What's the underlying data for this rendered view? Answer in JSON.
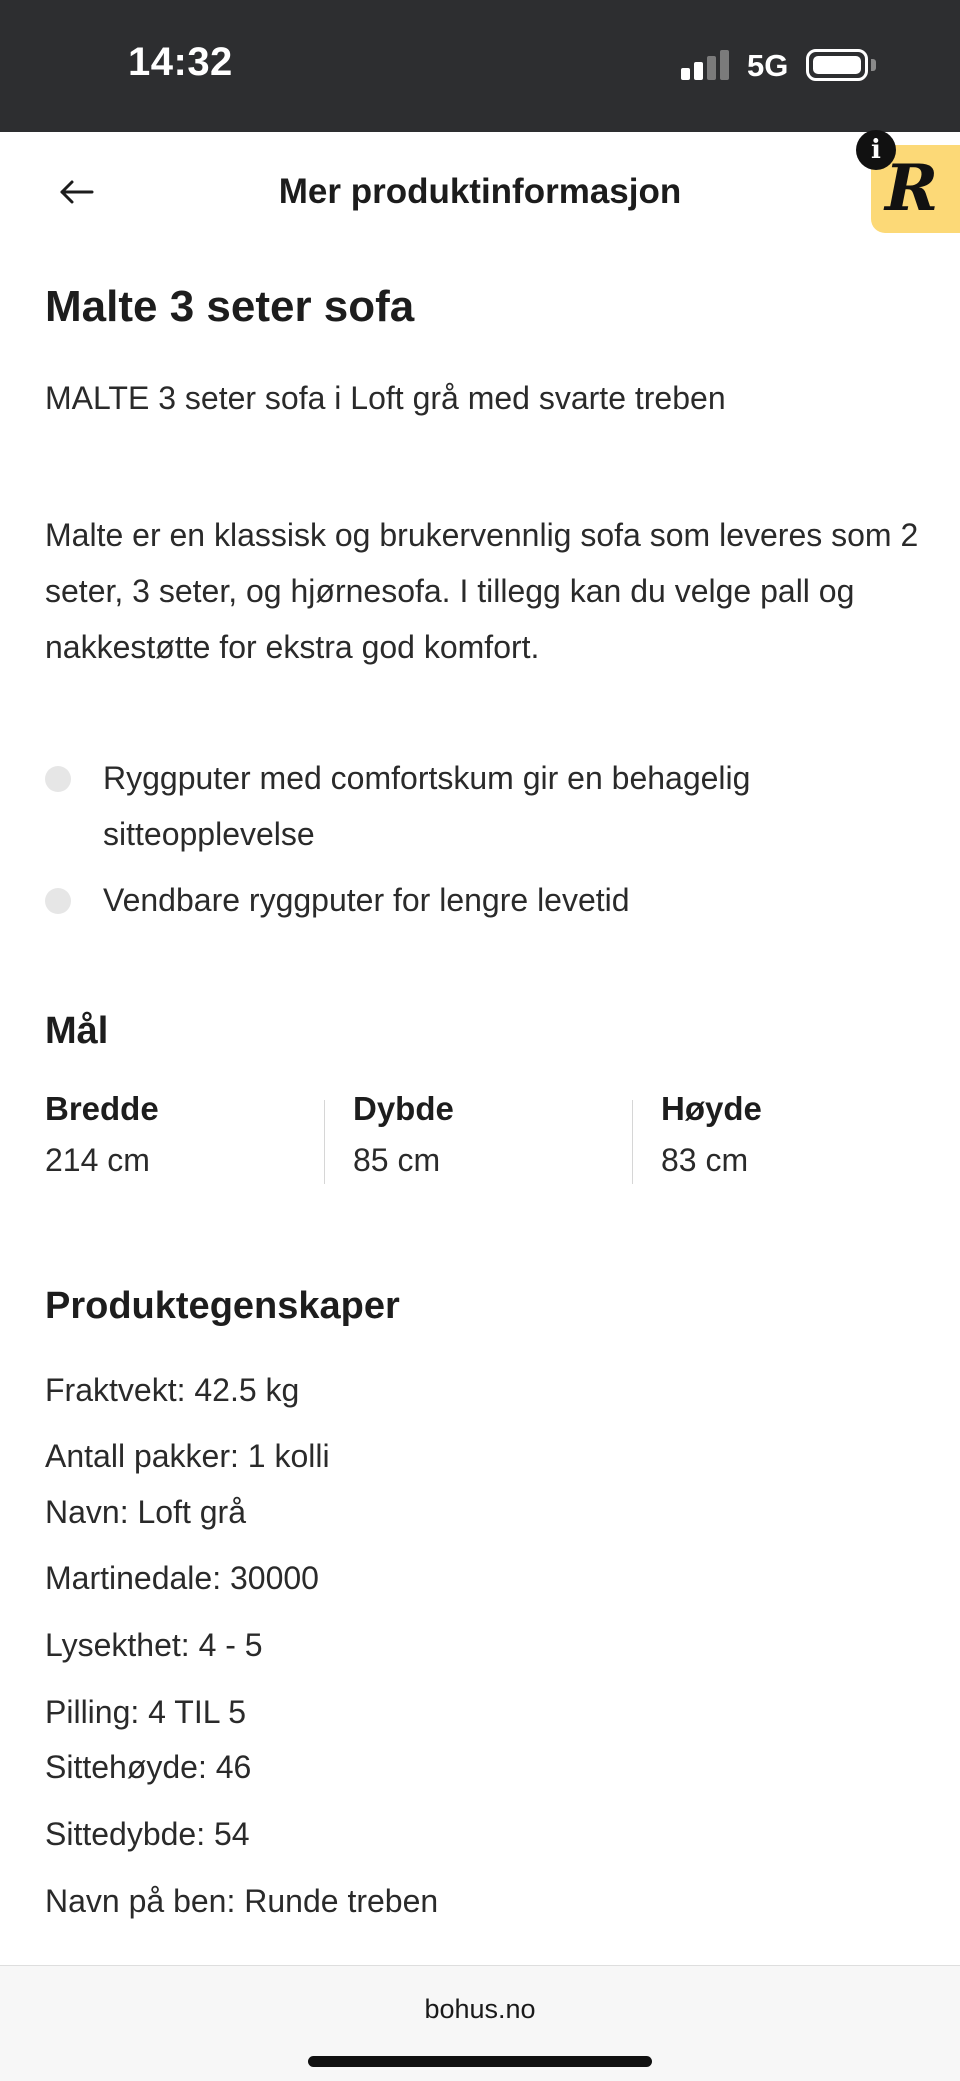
{
  "status_bar": {
    "time": "14:32",
    "network": "5G"
  },
  "header": {
    "title": "Mer produktinformasjon",
    "extension_badge": "R",
    "info_badge": "i"
  },
  "product": {
    "title": "Malte 3 seter sofa",
    "subtitle": "MALTE 3 seter sofa i Loft grå med svarte treben",
    "description": "Malte er en klassisk og brukervennlig sofa som leveres som 2 seter, 3 seter, og hjørnesofa. I tillegg kan du velge pall og nakkestøtte for ekstra god komfort.",
    "bullets": [
      "Ryggputer med comfortskum gir en behagelig sitteopplevelse",
      "Vendbare ryggputer for lengre levetid"
    ]
  },
  "dimensions": {
    "heading": "Mål",
    "items": [
      {
        "label": "Bredde",
        "value": "214 cm"
      },
      {
        "label": "Dybde",
        "value": "85 cm"
      },
      {
        "label": "Høyde",
        "value": "83 cm"
      }
    ]
  },
  "properties": {
    "heading": "Produktegenskaper",
    "items": [
      "Fraktvekt: 42.5 kg",
      "Antall pakker: 1 kolli",
      "Navn: Loft grå",
      "Martinedale: 30000",
      "Lysekthet: 4 - 5",
      "Pilling: 4 TIL 5",
      "Sittehøyde: 46",
      "Sittedybde: 54",
      "Navn på ben: Runde treben"
    ]
  },
  "browser": {
    "url": "bohus.no"
  }
}
